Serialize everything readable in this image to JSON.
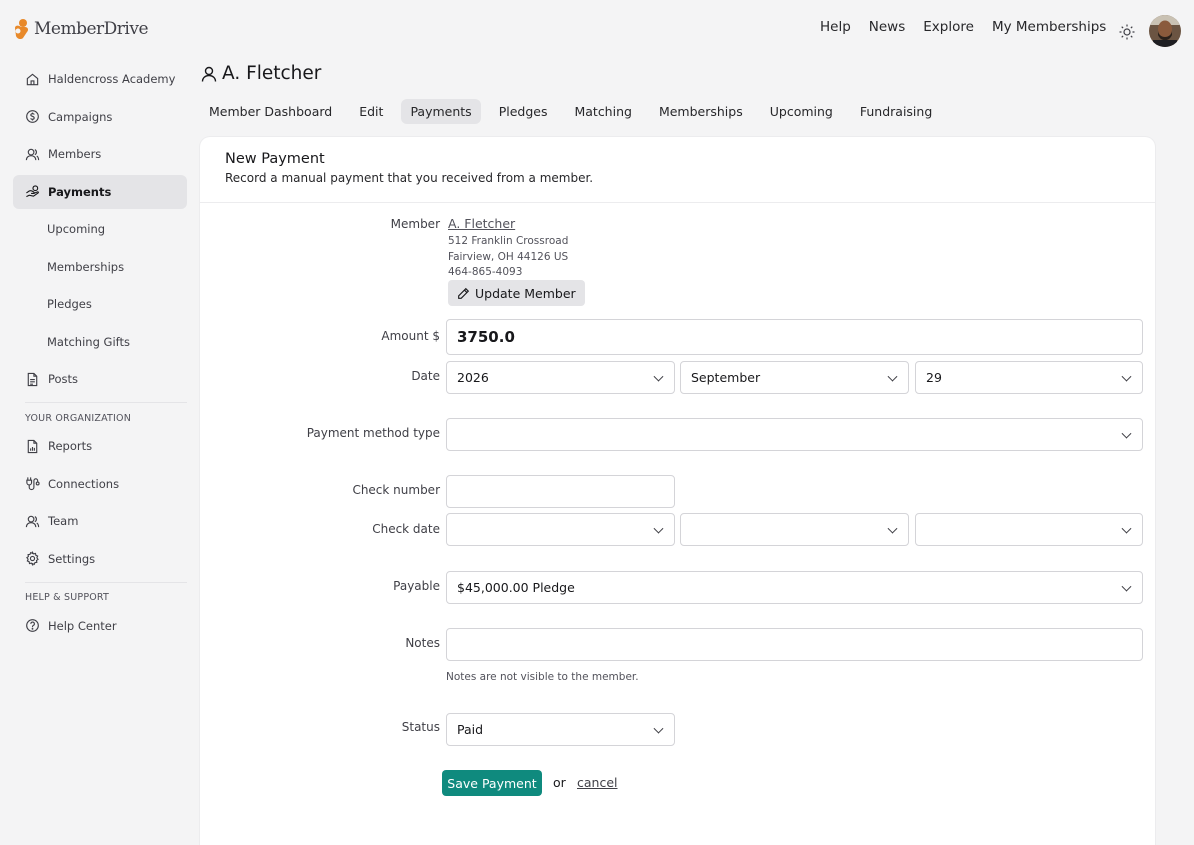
{
  "brand": {
    "name": "MemberDrive"
  },
  "topnav": [
    "Help",
    "News",
    "Explore",
    "My Memberships"
  ],
  "sidebar": {
    "items": [
      {
        "label": "Haldencross Academy",
        "icon": "home-icon"
      },
      {
        "label": "Campaigns",
        "icon": "dollar-circle-icon"
      },
      {
        "label": "Members",
        "icon": "users-icon"
      },
      {
        "label": "Payments",
        "icon": "hand-coins-icon",
        "active": true
      },
      {
        "label": "Upcoming"
      },
      {
        "label": "Memberships"
      },
      {
        "label": "Pledges"
      },
      {
        "label": "Matching Gifts"
      },
      {
        "label": "Posts",
        "icon": "document-icon"
      }
    ],
    "org_heading": "YOUR ORGANIZATION",
    "org_items": [
      {
        "label": "Reports",
        "icon": "report-icon"
      },
      {
        "label": "Connections",
        "icon": "plug-icon"
      },
      {
        "label": "Team",
        "icon": "users-icon"
      },
      {
        "label": "Settings",
        "icon": "gear-icon"
      }
    ],
    "help_heading": "HELP & SUPPORT",
    "help_items": [
      {
        "label": "Help Center",
        "icon": "question-circle-icon"
      }
    ]
  },
  "page": {
    "title": "A. Fletcher",
    "tabs": [
      "Member Dashboard",
      "Edit",
      "Payments",
      "Pledges",
      "Matching",
      "Memberships",
      "Upcoming",
      "Fundraising"
    ],
    "active_tab": "Payments"
  },
  "form": {
    "title": "New Payment",
    "subtitle": "Record a manual payment that you received from a member.",
    "member_label": "Member",
    "member_name": "A. Fletcher",
    "address_line1": "512 Franklin Crossroad",
    "address_line2": "Fairview, OH 44126 US",
    "phone": "464-865-4093",
    "update_member_label": "Update Member",
    "amount_label": "Amount $",
    "amount_value": "3750.0",
    "date_label": "Date",
    "date_year": "2026",
    "date_month": "September",
    "date_day": "29",
    "payment_method_label": "Payment method type",
    "payment_method_value": "",
    "check_number_label": "Check number",
    "check_number_value": "",
    "check_date_label": "Check date",
    "payable_label": "Payable",
    "payable_value": "$45,000.00 Pledge",
    "notes_label": "Notes",
    "notes_value": "",
    "notes_hint": "Notes are not visible to the member.",
    "status_label": "Status",
    "status_value": "Paid",
    "save_label": "Save Payment",
    "or_text": "or",
    "cancel_label": "cancel"
  },
  "colors": {
    "accent": "#0f8a7e",
    "logo": "#e8892a"
  }
}
